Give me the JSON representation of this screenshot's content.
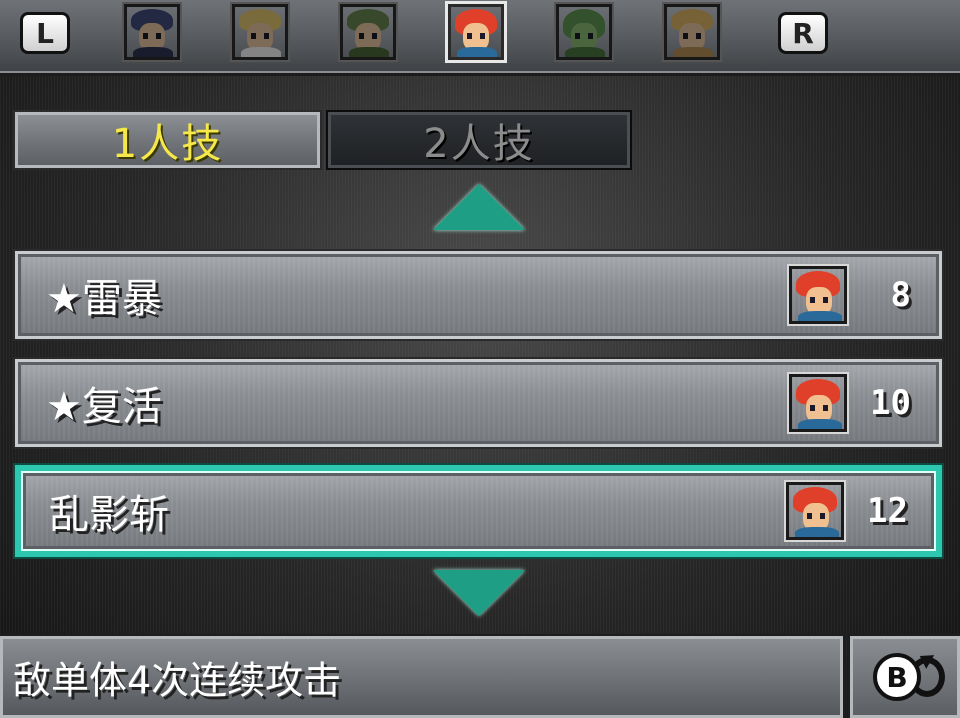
{
  "topbar": {
    "left_shoulder": "L",
    "right_shoulder": "R",
    "characters": [
      {
        "icon": "character-portrait-magus",
        "hair": "#3a4a8c",
        "body": "#2a3260",
        "active": false
      },
      {
        "icon": "character-portrait-marle",
        "hair": "#e6c34a",
        "body": "#f0f0f0",
        "active": false
      },
      {
        "icon": "character-portrait-lucca",
        "hair": "#5a8a3a",
        "body": "#3f6a2a",
        "active": false
      },
      {
        "icon": "character-portrait-crono",
        "hair": "#e0402a",
        "body": "#2a6a9a",
        "active": true
      },
      {
        "icon": "character-portrait-frog",
        "hair": "#4a9a3a",
        "body": "#3a7a2a",
        "active": false
      },
      {
        "icon": "character-portrait-ayla",
        "hair": "#e8b040",
        "body": "#c08a3a",
        "active": false
      }
    ]
  },
  "tabs": {
    "single": "1人技",
    "dual": "2人技"
  },
  "skills": [
    {
      "name": "★雷暴",
      "cost": "8",
      "icon": "character-portrait-crono",
      "selected": false
    },
    {
      "name": "★复活",
      "cost": "10",
      "icon": "character-portrait-crono",
      "selected": false
    },
    {
      "name": "乱影斩",
      "cost": "12",
      "icon": "character-portrait-crono",
      "selected": true
    }
  ],
  "description": "敌单体4次连续攻击",
  "back_button": {
    "label": "B",
    "icon": "back-arrow-icon"
  },
  "colors": {
    "accent": "#2cc7ae",
    "active_tab_text": "#f6e84a",
    "inactive_tab_text": "#8c8c8c"
  }
}
